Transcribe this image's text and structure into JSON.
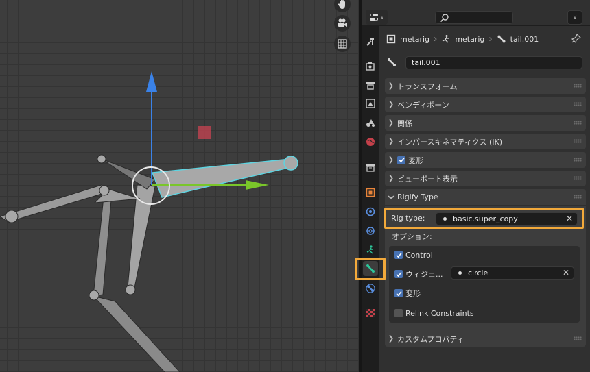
{
  "breadcrumb": {
    "object": "metarig",
    "armature": "metarig",
    "bone": "tail.001"
  },
  "bone_name": "tail.001",
  "panels": {
    "transform": "トランスフォーム",
    "bendy_bones": "ベンディボーン",
    "relations": "関係",
    "inverse_kinematics": "インバースキネマティクス (IK)",
    "deform": "変形",
    "viewport_display": "ビューポート表示",
    "rigify_type": "Rigify Type",
    "custom_properties": "カスタムプロパティ"
  },
  "rigify": {
    "rig_type_label": "Rig type:",
    "rig_type_value": "basic.super_copy",
    "options_label": "オプション:",
    "options": {
      "control": "Control",
      "widget": "ウィジェ...",
      "widget_value": "circle",
      "deform": "変形",
      "relink": "Relink Constraints"
    }
  },
  "colors": {
    "highlight": "#f2a93b",
    "checkbox": "#4772b3",
    "bone_selected": "#5fd3e0",
    "axis_y": "#7ac62a",
    "axis_z": "#3a82e8"
  },
  "icons": [
    "hand-icon",
    "camera-icon",
    "grid-icon",
    "search-icon",
    "tool-icon",
    "render-icon",
    "output-icon",
    "view-layer-icon",
    "scene-icon",
    "world-icon",
    "collection-icon",
    "object-icon",
    "modifier-icon",
    "physics-icon",
    "armature-data-icon",
    "bone-icon",
    "bone-constraint-icon",
    "texture-icon",
    "pin-icon"
  ]
}
